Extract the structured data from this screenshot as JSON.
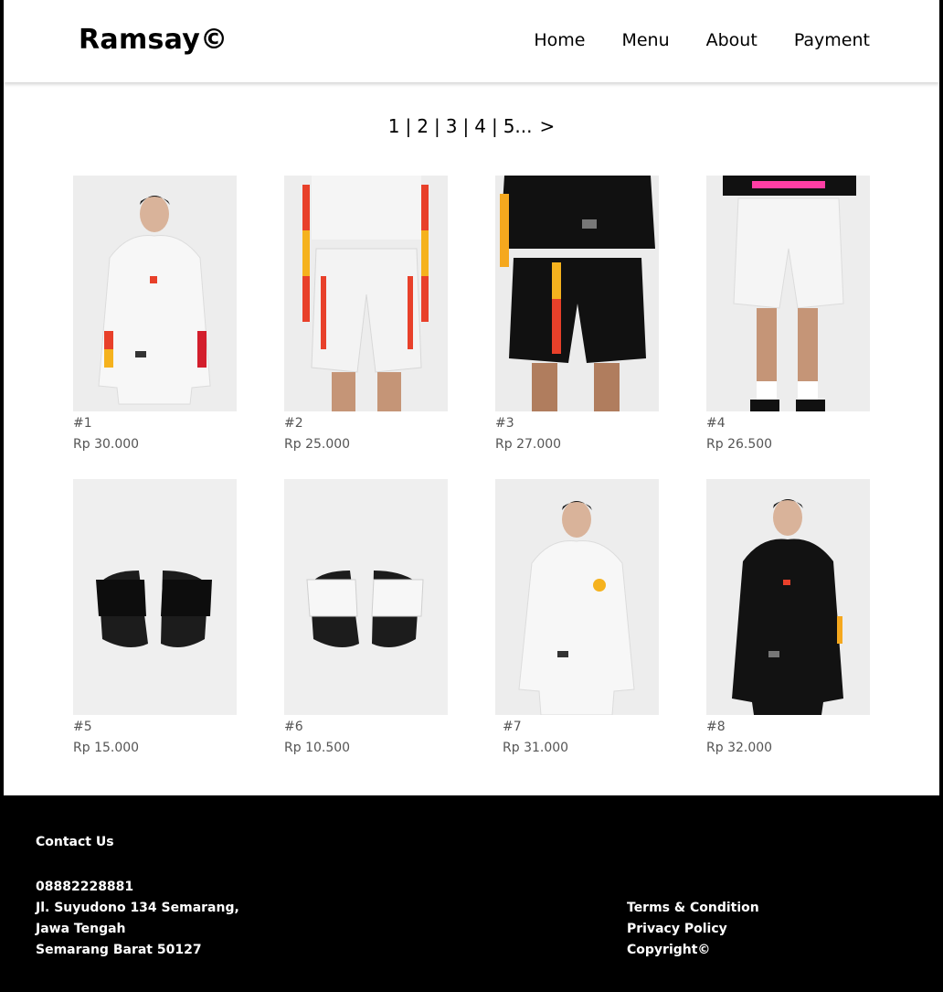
{
  "header": {
    "logo": "Ramsay©",
    "nav": [
      "Home",
      "Menu",
      "About",
      "Payment"
    ]
  },
  "pagination": {
    "pages": [
      "1",
      "2",
      "3",
      "4",
      "5..."
    ],
    "next": ">"
  },
  "products": [
    {
      "label": "#1",
      "price": "Rp 30.000",
      "image": "white-hoodie-model"
    },
    {
      "label": "#2",
      "price": "Rp 25.000",
      "image": "white-shorts-model"
    },
    {
      "label": "#3",
      "price": "Rp 27.000",
      "image": "black-shorts-model"
    },
    {
      "label": "#4",
      "price": "Rp 26.500",
      "image": "white-shorts-front"
    },
    {
      "label": "#5",
      "price": "Rp 15.000",
      "image": "black-slides"
    },
    {
      "label": "#6",
      "price": "Rp 10.500",
      "image": "white-slides"
    },
    {
      "label": "#7",
      "price": "Rp 31.000",
      "image": "white-hoodie-sun"
    },
    {
      "label": "#8",
      "price": "Rp 32.000",
      "image": "black-hoodie-model"
    }
  ],
  "footer": {
    "contact_title": "Contact Us",
    "phone": "08882228881",
    "address_line1": "Jl. Suyudono 134 Semarang,",
    "address_line2": "Jawa Tengah",
    "address_line3": "Semarang Barat 50127",
    "links": [
      "Terms & Condition",
      "Privacy Policy",
      "Copyright©"
    ]
  },
  "colors": {
    "footer_bg": "#000000",
    "text": "#000000",
    "muted": "#555555"
  }
}
